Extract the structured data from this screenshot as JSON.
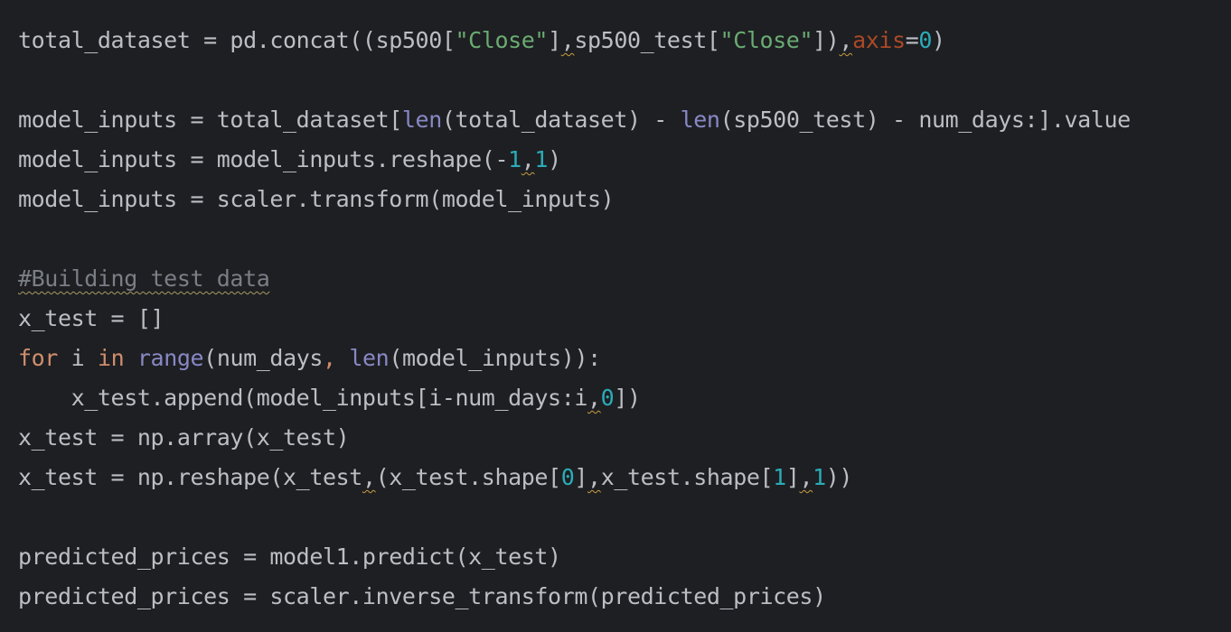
{
  "editor": {
    "lines": [
      [
        {
          "t": "total_dataset = pd.concat((sp500[",
          "k": "plain"
        },
        {
          "t": "\"Close\"",
          "k": "str"
        },
        {
          "t": "]",
          "k": "plain"
        },
        {
          "t": ",",
          "k": "plain",
          "w": true
        },
        {
          "t": "sp500_test[",
          "k": "plain"
        },
        {
          "t": "\"Close\"",
          "k": "str"
        },
        {
          "t": "])",
          "k": "plain"
        },
        {
          "t": ",",
          "k": "plain",
          "w": true
        },
        {
          "t": "axis",
          "k": "param"
        },
        {
          "t": "=",
          "k": "plain"
        },
        {
          "t": "0",
          "k": "num"
        },
        {
          "t": ")",
          "k": "plain"
        }
      ],
      [],
      [
        {
          "t": "model_inputs = total_dataset[",
          "k": "plain"
        },
        {
          "t": "len",
          "k": "builtin"
        },
        {
          "t": "(total_dataset) - ",
          "k": "plain"
        },
        {
          "t": "len",
          "k": "builtin"
        },
        {
          "t": "(sp500_test) - num_days:].value",
          "k": "plain"
        }
      ],
      [
        {
          "t": "model_inputs = model_inputs.reshape(-",
          "k": "plain"
        },
        {
          "t": "1",
          "k": "num"
        },
        {
          "t": ",",
          "k": "plain",
          "w": true
        },
        {
          "t": "1",
          "k": "num"
        },
        {
          "t": ")",
          "k": "plain"
        }
      ],
      [
        {
          "t": "model_inputs = scaler.transform(model_inputs)",
          "k": "plain"
        }
      ],
      [],
      [
        {
          "t": "#Building test data",
          "k": "comment",
          "w": true
        }
      ],
      [
        {
          "t": "x_test = []",
          "k": "plain"
        }
      ],
      [
        {
          "t": "for",
          "k": "kw"
        },
        {
          "t": " i ",
          "k": "plain"
        },
        {
          "t": "in",
          "k": "kw"
        },
        {
          "t": " ",
          "k": "plain"
        },
        {
          "t": "range",
          "k": "builtin"
        },
        {
          "t": "(num_days",
          "k": "plain"
        },
        {
          "t": ",",
          "k": "kw"
        },
        {
          "t": " ",
          "k": "plain"
        },
        {
          "t": "len",
          "k": "builtin"
        },
        {
          "t": "(model_inputs)):",
          "k": "plain"
        }
      ],
      [
        {
          "t": "    x_test.append(model_inputs[i-num_days:i",
          "k": "plain"
        },
        {
          "t": ",",
          "k": "plain",
          "w": true
        },
        {
          "t": "0",
          "k": "num"
        },
        {
          "t": "])",
          "k": "plain"
        }
      ],
      [
        {
          "t": "x_test = np.array(x_test)",
          "k": "plain"
        }
      ],
      [
        {
          "t": "x_test = np.reshape(x_test",
          "k": "plain"
        },
        {
          "t": ",",
          "k": "plain",
          "w": true
        },
        {
          "t": "(x_test.shape[",
          "k": "plain"
        },
        {
          "t": "0",
          "k": "num"
        },
        {
          "t": "]",
          "k": "plain"
        },
        {
          "t": ",",
          "k": "plain",
          "w": true
        },
        {
          "t": "x_test.shape[",
          "k": "plain"
        },
        {
          "t": "1",
          "k": "num"
        },
        {
          "t": "]",
          "k": "plain"
        },
        {
          "t": ",",
          "k": "plain",
          "w": true
        },
        {
          "t": "1",
          "k": "num"
        },
        {
          "t": "))",
          "k": "plain"
        }
      ],
      [],
      [
        {
          "t": "predicted_prices = model1.predict(x_test)",
          "k": "plain"
        }
      ],
      [
        {
          "t": "predicted_prices = scaler.inverse_transform(predicted_prices)",
          "k": "plain"
        }
      ]
    ]
  }
}
